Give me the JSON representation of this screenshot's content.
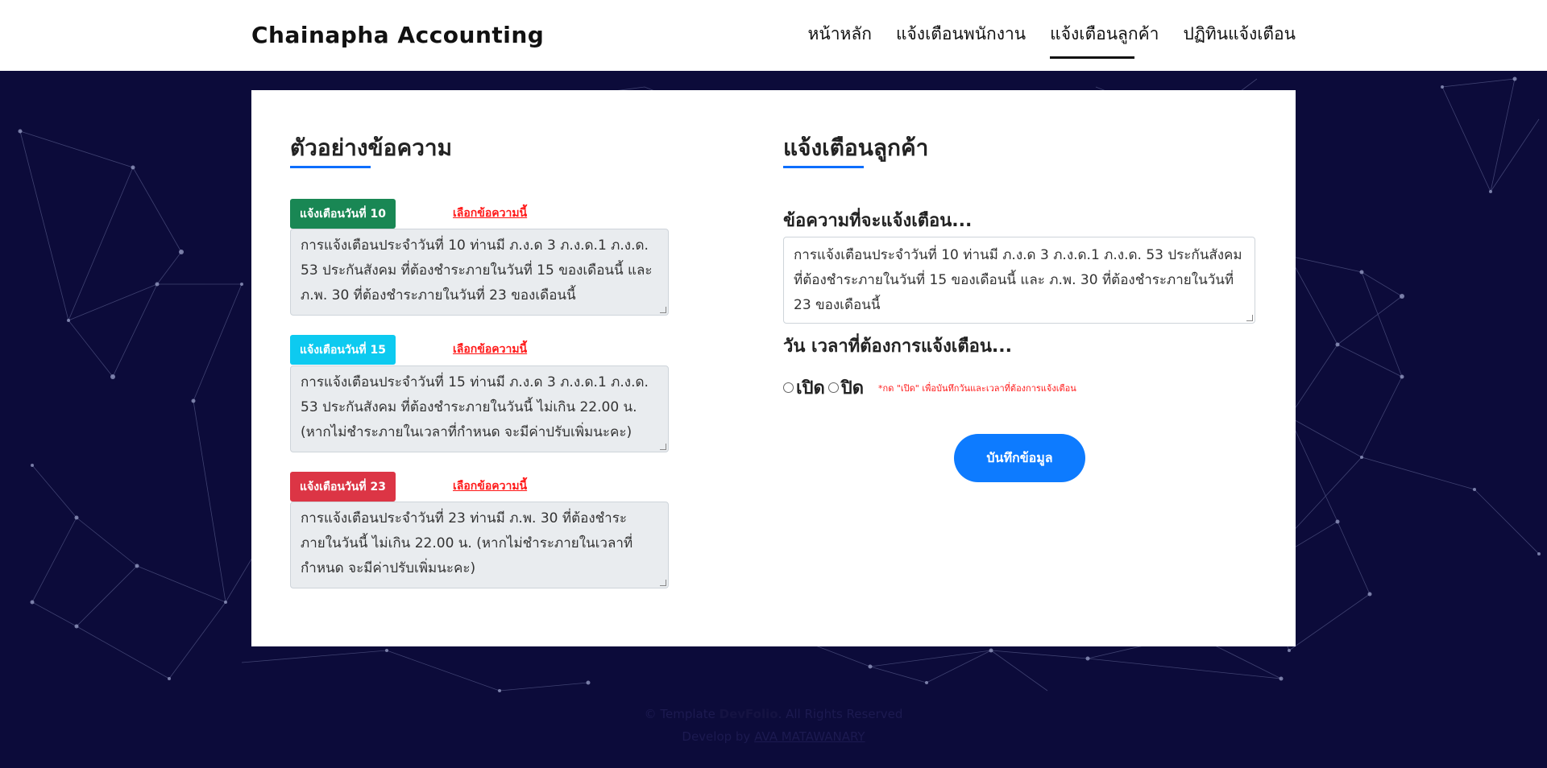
{
  "navbar": {
    "brand": "Chainapha Accounting",
    "links": [
      {
        "label": "หน้าหลัก"
      },
      {
        "label": "แจ้งเตือนพนักงาน"
      },
      {
        "label": "แจ้งเตือนลูกค้า"
      },
      {
        "label": "ปฏิทินแจ้งเตือน"
      }
    ]
  },
  "left": {
    "title": "ตัวอย่างข้อความ",
    "select_label": "เลือกข้อความนี้",
    "templates": [
      {
        "badge": "แจ้งเตือนวันที่ 10",
        "badge_color": "#198754",
        "text": "การแจ้งเตือนประจำวันที่ 10 ท่านมี ภ.ง.ด 3 ภ.ง.ด.1 ภ.ง.ด. 53 ประกันสังคม ที่ต้องชำระภายในวันที่ 15 ของเดือนนี้ และ ภ.พ. 30 ที่ต้องชำระภายในวันที่ 23 ของเดือนนี้"
      },
      {
        "badge": "แจ้งเตือนวันที่ 15",
        "badge_color": "#0dcaf0",
        "text": "การแจ้งเตือนประจำวันที่ 15 ท่านมี ภ.ง.ด 3 ภ.ง.ด.1 ภ.ง.ด. 53 ประกันสังคม ที่ต้องชำระภายในวันนี้ ไม่เกิน 22.00 น. (หากไม่ชำระภายในเวลาที่กำหนด จะมีค่าปรับเพิ่มนะคะ)"
      },
      {
        "badge": "แจ้งเตือนวันที่ 23",
        "badge_color": "#dc3545",
        "text": "การแจ้งเตือนประจำวันที่ 23 ท่านมี ภ.พ. 30 ที่ต้องชำระภายในวันนี้ ไม่เกิน 22.00 น. (หากไม่ชำระภายในเวลาที่กำหนด จะมีค่าปรับเพิ่มนะคะ)"
      }
    ]
  },
  "right": {
    "title": "แจ้งเตือนลูกค้า",
    "message_label": "ข้อความที่จะแจ้งเตือน...",
    "message_value": "การแจ้งเตือนประจำวันที่ 10 ท่านมี ภ.ง.ด 3 ภ.ง.ด.1 ภ.ง.ด. 53 ประกันสังคม ที่ต้องชำระภายในวันที่ 15 ของเดือนนี้ และ ภ.พ. 30 ที่ต้องชำระภายในวันที่ 23 ของเดือนนี้",
    "datetime_label": "วัน เวลาที่ต้องการแจ้งเตือน...",
    "radio_on": "เปิด",
    "radio_off": "ปิด",
    "hint": "*กด \"เปิด\" เพื่อบันทึกวันและเวลาที่ต้องการแจ้งเตือน",
    "save_label": "บันทึกข้อมูล"
  },
  "footer": {
    "line1_prefix": "© Template",
    "line1_brand": "DevFolio",
    "line1_suffix": ". All Rights Reserved",
    "line2_prefix": "Develop by",
    "line2_link": "AVA MATAWANARY"
  },
  "colors": {
    "accent": "#0d6efd",
    "background": "#0c0b3a"
  }
}
